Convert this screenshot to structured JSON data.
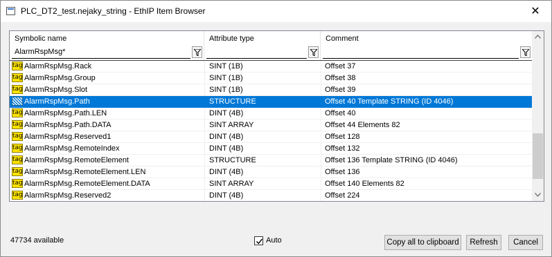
{
  "window": {
    "title": "PLC_DT2_test.nejaky_string - EthIP Item Browser",
    "close_glyph": "✕",
    "app_icon": "window-icon"
  },
  "grid": {
    "columns": [
      {
        "label": "Symbolic name",
        "filter": "AlarmRspMsg*"
      },
      {
        "label": "Attribute type",
        "filter": ""
      },
      {
        "label": "Comment",
        "filter": ""
      }
    ],
    "filter_icon": "filter-funnel-icon",
    "tag_icon_label": "tag",
    "rows": [
      {
        "name": "AlarmRspMsg.Rack",
        "type": "SINT (1B)",
        "comment": "Offset 37",
        "icon": "tag",
        "selected": false
      },
      {
        "name": "AlarmRspMsg.Group",
        "type": "SINT (1B)",
        "comment": "Offset 38",
        "icon": "tag",
        "selected": false
      },
      {
        "name": "AlarmRspMsg.Slot",
        "type": "SINT (1B)",
        "comment": "Offset 39",
        "icon": "tag",
        "selected": false
      },
      {
        "name": "AlarmRspMsg.Path",
        "type": "STRUCTURE",
        "comment": "Offset 40 Template STRING (ID 4046)",
        "icon": "struct",
        "selected": true
      },
      {
        "name": "AlarmRspMsg.Path.LEN",
        "type": "DINT (4B)",
        "comment": "Offset 40",
        "icon": "tag",
        "selected": false
      },
      {
        "name": "AlarmRspMsg.Path.DATA",
        "type": "SINT ARRAY",
        "comment": "Offset 44  Elements 82",
        "icon": "tag",
        "selected": false
      },
      {
        "name": "AlarmRspMsg.Reserved1",
        "type": "DINT (4B)",
        "comment": "Offset 128",
        "icon": "tag",
        "selected": false
      },
      {
        "name": "AlarmRspMsg.RemoteIndex",
        "type": "DINT (4B)",
        "comment": "Offset 132",
        "icon": "tag",
        "selected": false
      },
      {
        "name": "AlarmRspMsg.RemoteElement",
        "type": "STRUCTURE",
        "comment": "Offset 136 Template STRING (ID 4046)",
        "icon": "tag",
        "selected": false
      },
      {
        "name": "AlarmRspMsg.RemoteElement.LEN",
        "type": "DINT (4B)",
        "comment": "Offset 136",
        "icon": "tag",
        "selected": false
      },
      {
        "name": "AlarmRspMsg.RemoteElement.DATA",
        "type": "SINT ARRAY",
        "comment": "Offset 140  Elements 82",
        "icon": "tag",
        "selected": false
      },
      {
        "name": "AlarmRspMsg.Reserved2",
        "type": "DINT (4B)",
        "comment": "Offset 224",
        "icon": "tag",
        "selected": false
      }
    ]
  },
  "footer": {
    "available": "47734 available",
    "auto_label": "Auto",
    "auto_checked": true,
    "copy_label": "Copy all to clipboard",
    "refresh_label": "Refresh",
    "cancel_label": "Cancel"
  },
  "colors": {
    "selection": "#0078d7",
    "tag_icon": "#ffe400",
    "button_face": "#e1e1e1"
  }
}
